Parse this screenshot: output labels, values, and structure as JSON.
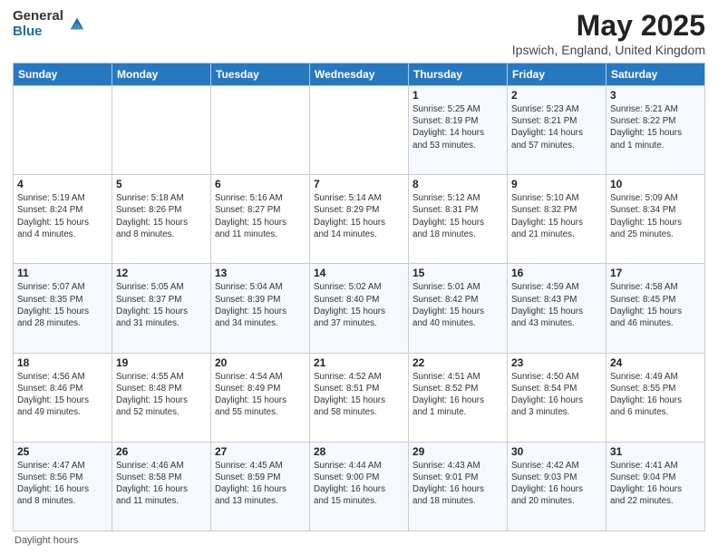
{
  "logo": {
    "general": "General",
    "blue": "Blue"
  },
  "header": {
    "title": "May 2025",
    "subtitle": "Ipswich, England, United Kingdom"
  },
  "weekdays": [
    "Sunday",
    "Monday",
    "Tuesday",
    "Wednesday",
    "Thursday",
    "Friday",
    "Saturday"
  ],
  "weeks": [
    [
      {
        "day": "",
        "info": ""
      },
      {
        "day": "",
        "info": ""
      },
      {
        "day": "",
        "info": ""
      },
      {
        "day": "",
        "info": ""
      },
      {
        "day": "1",
        "info": "Sunrise: 5:25 AM\nSunset: 8:19 PM\nDaylight: 14 hours\nand 53 minutes."
      },
      {
        "day": "2",
        "info": "Sunrise: 5:23 AM\nSunset: 8:21 PM\nDaylight: 14 hours\nand 57 minutes."
      },
      {
        "day": "3",
        "info": "Sunrise: 5:21 AM\nSunset: 8:22 PM\nDaylight: 15 hours\nand 1 minute."
      }
    ],
    [
      {
        "day": "4",
        "info": "Sunrise: 5:19 AM\nSunset: 8:24 PM\nDaylight: 15 hours\nand 4 minutes."
      },
      {
        "day": "5",
        "info": "Sunrise: 5:18 AM\nSunset: 8:26 PM\nDaylight: 15 hours\nand 8 minutes."
      },
      {
        "day": "6",
        "info": "Sunrise: 5:16 AM\nSunset: 8:27 PM\nDaylight: 15 hours\nand 11 minutes."
      },
      {
        "day": "7",
        "info": "Sunrise: 5:14 AM\nSunset: 8:29 PM\nDaylight: 15 hours\nand 14 minutes."
      },
      {
        "day": "8",
        "info": "Sunrise: 5:12 AM\nSunset: 8:31 PM\nDaylight: 15 hours\nand 18 minutes."
      },
      {
        "day": "9",
        "info": "Sunrise: 5:10 AM\nSunset: 8:32 PM\nDaylight: 15 hours\nand 21 minutes."
      },
      {
        "day": "10",
        "info": "Sunrise: 5:09 AM\nSunset: 8:34 PM\nDaylight: 15 hours\nand 25 minutes."
      }
    ],
    [
      {
        "day": "11",
        "info": "Sunrise: 5:07 AM\nSunset: 8:35 PM\nDaylight: 15 hours\nand 28 minutes."
      },
      {
        "day": "12",
        "info": "Sunrise: 5:05 AM\nSunset: 8:37 PM\nDaylight: 15 hours\nand 31 minutes."
      },
      {
        "day": "13",
        "info": "Sunrise: 5:04 AM\nSunset: 8:39 PM\nDaylight: 15 hours\nand 34 minutes."
      },
      {
        "day": "14",
        "info": "Sunrise: 5:02 AM\nSunset: 8:40 PM\nDaylight: 15 hours\nand 37 minutes."
      },
      {
        "day": "15",
        "info": "Sunrise: 5:01 AM\nSunset: 8:42 PM\nDaylight: 15 hours\nand 40 minutes."
      },
      {
        "day": "16",
        "info": "Sunrise: 4:59 AM\nSunset: 8:43 PM\nDaylight: 15 hours\nand 43 minutes."
      },
      {
        "day": "17",
        "info": "Sunrise: 4:58 AM\nSunset: 8:45 PM\nDaylight: 15 hours\nand 46 minutes."
      }
    ],
    [
      {
        "day": "18",
        "info": "Sunrise: 4:56 AM\nSunset: 8:46 PM\nDaylight: 15 hours\nand 49 minutes."
      },
      {
        "day": "19",
        "info": "Sunrise: 4:55 AM\nSunset: 8:48 PM\nDaylight: 15 hours\nand 52 minutes."
      },
      {
        "day": "20",
        "info": "Sunrise: 4:54 AM\nSunset: 8:49 PM\nDaylight: 15 hours\nand 55 minutes."
      },
      {
        "day": "21",
        "info": "Sunrise: 4:52 AM\nSunset: 8:51 PM\nDaylight: 15 hours\nand 58 minutes."
      },
      {
        "day": "22",
        "info": "Sunrise: 4:51 AM\nSunset: 8:52 PM\nDaylight: 16 hours\nand 1 minute."
      },
      {
        "day": "23",
        "info": "Sunrise: 4:50 AM\nSunset: 8:54 PM\nDaylight: 16 hours\nand 3 minutes."
      },
      {
        "day": "24",
        "info": "Sunrise: 4:49 AM\nSunset: 8:55 PM\nDaylight: 16 hours\nand 6 minutes."
      }
    ],
    [
      {
        "day": "25",
        "info": "Sunrise: 4:47 AM\nSunset: 8:56 PM\nDaylight: 16 hours\nand 8 minutes."
      },
      {
        "day": "26",
        "info": "Sunrise: 4:46 AM\nSunset: 8:58 PM\nDaylight: 16 hours\nand 11 minutes."
      },
      {
        "day": "27",
        "info": "Sunrise: 4:45 AM\nSunset: 8:59 PM\nDaylight: 16 hours\nand 13 minutes."
      },
      {
        "day": "28",
        "info": "Sunrise: 4:44 AM\nSunset: 9:00 PM\nDaylight: 16 hours\nand 15 minutes."
      },
      {
        "day": "29",
        "info": "Sunrise: 4:43 AM\nSunset: 9:01 PM\nDaylight: 16 hours\nand 18 minutes."
      },
      {
        "day": "30",
        "info": "Sunrise: 4:42 AM\nSunset: 9:03 PM\nDaylight: 16 hours\nand 20 minutes."
      },
      {
        "day": "31",
        "info": "Sunrise: 4:41 AM\nSunset: 9:04 PM\nDaylight: 16 hours\nand 22 minutes."
      }
    ]
  ],
  "footer": {
    "daylight_hours": "Daylight hours"
  }
}
